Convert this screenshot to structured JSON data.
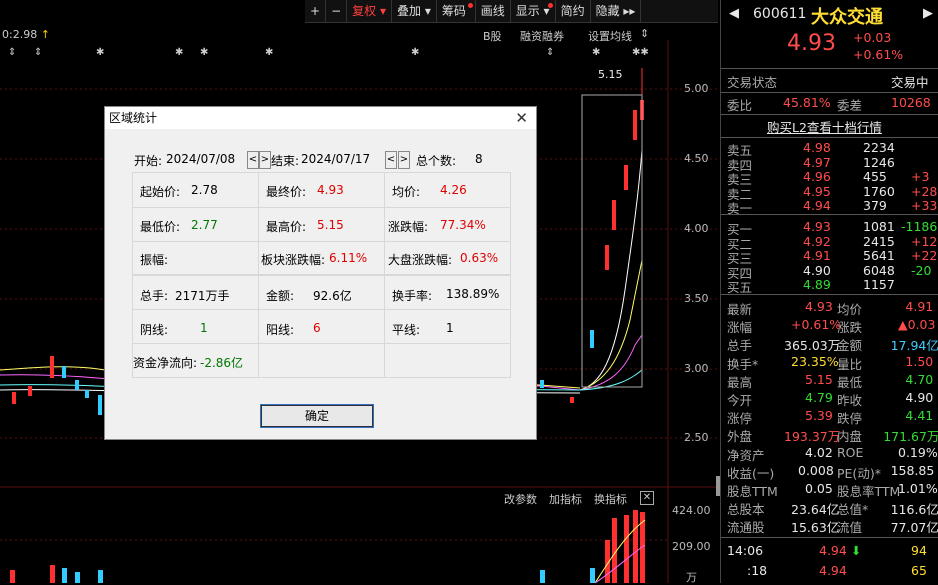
{
  "toolbar": {
    "buttons": [
      "+",
      "−",
      "复权",
      "叠加",
      "筹码",
      "画线",
      "显示",
      "简约",
      "隐藏"
    ]
  },
  "chart_header": {
    "left_label": "0:2.98",
    "right_items": [
      "B股",
      "融资融券",
      "设置均线"
    ],
    "peak_label": "5.15"
  },
  "price_axis": [
    "5.00",
    "4.50",
    "4.00",
    "3.50",
    "3.00",
    "2.50"
  ],
  "volume_header": [
    "改参数",
    "加指标",
    "换指标"
  ],
  "volume_axis": [
    "424.00",
    "209.00",
    "万"
  ],
  "dialog": {
    "title": "区域统计",
    "start_label": "开始:",
    "start_date": "2024/07/08",
    "end_label": "结束:",
    "end_date": "2024/07/17",
    "count_label": "总个数:",
    "count": "8",
    "open_label": "起始价:",
    "open": "2.78",
    "close_label": "最终价:",
    "close": "4.93",
    "avg_label": "均价:",
    "avg": "4.26",
    "low_label": "最低价:",
    "low": "2.77",
    "high_label": "最高价:",
    "high": "5.15",
    "chg_label": "涨跌幅:",
    "chg": "77.34%",
    "amp_label": "振幅:",
    "sector_label": "板块涨跌幅:",
    "sector": "6.11%",
    "market_label": "大盘涨跌幅:",
    "market": "0.63%",
    "hand_label": "总手:",
    "hand": "2171万手",
    "amount_label": "金额:",
    "amount": "92.6亿",
    "turnover_label": "换手率:",
    "turnover": "138.89%",
    "yin_label": "阴线:",
    "yin": "1",
    "yang_label": "阳线:",
    "yang": "6",
    "flat_label": "平线:",
    "flat": "1",
    "flow_label": "资金净流向:",
    "flow": "-2.86亿",
    "ok": "确定"
  },
  "quote": {
    "code": "600611",
    "name": "大众交通",
    "price": "4.93",
    "change": "+0.03",
    "change_pct": "+0.61%",
    "status_label": "交易状态",
    "status": "交易中",
    "webi_label": "委比",
    "webi": "45.81%",
    "weicha_label": "委差",
    "weicha": "10268",
    "l2_link": "购买L2查看十档行情",
    "asks": [
      {
        "label": "卖五",
        "price": "4.98",
        "vol": "2234",
        "chg": ""
      },
      {
        "label": "卖四",
        "price": "4.97",
        "vol": "1246",
        "chg": ""
      },
      {
        "label": "卖三",
        "price": "4.96",
        "vol": "455",
        "chg": "+3"
      },
      {
        "label": "卖二",
        "price": "4.95",
        "vol": "1760",
        "chg": "+28"
      },
      {
        "label": "卖一",
        "price": "4.94",
        "vol": "379",
        "chg": "+33"
      }
    ],
    "bids": [
      {
        "label": "买一",
        "price": "4.93",
        "vol": "1081",
        "chg": "-1186"
      },
      {
        "label": "买二",
        "price": "4.92",
        "vol": "2415",
        "chg": "+12"
      },
      {
        "label": "买三",
        "price": "4.91",
        "vol": "5641",
        "chg": "+22"
      },
      {
        "label": "买四",
        "price": "4.90",
        "vol": "6048",
        "chg": "-20"
      },
      {
        "label": "买五",
        "price": "4.89",
        "vol": "1157",
        "chg": ""
      }
    ],
    "stats": [
      {
        "l1": "最新",
        "v1": "4.93",
        "l2": "均价",
        "v2": "4.91"
      },
      {
        "l1": "涨幅",
        "v1": "+0.61%",
        "l2": "涨跌",
        "v2": "▲0.03"
      },
      {
        "l1": "总手",
        "v1": "365.03万",
        "l2": "金额",
        "v2": "17.94亿"
      },
      {
        "l1": "换手*",
        "v1": "23.35%",
        "l2": "量比",
        "v2": "1.50"
      },
      {
        "l1": "最高",
        "v1": "5.15",
        "l2": "最低",
        "v2": "4.70"
      },
      {
        "l1": "今开",
        "v1": "4.79",
        "l2": "昨收",
        "v2": "4.90"
      },
      {
        "l1": "涨停",
        "v1": "5.39",
        "l2": "跌停",
        "v2": "4.41"
      },
      {
        "l1": "外盘",
        "v1": "193.37万",
        "l2": "内盘",
        "v2": "171.67万"
      },
      {
        "l1": "净资产",
        "v1": "4.02",
        "l2": "ROE",
        "v2": "0.19%"
      },
      {
        "l1": "收益(一)",
        "v1": "0.008",
        "l2": "PE(动)*",
        "v2": "158.85"
      },
      {
        "l1": "股息TTM",
        "v1": "0.05",
        "l2": "股息率TTM",
        "v2": "1.01%"
      },
      {
        "l1": "总股本",
        "v1": "23.64亿",
        "l2": "总值*",
        "v2": "116.6亿"
      },
      {
        "l1": "流通股",
        "v1": "15.63亿",
        "l2": "流值",
        "v2": "77.07亿"
      }
    ],
    "ticks": [
      {
        "time": "14:06",
        "price": "4.94",
        "vol": "94"
      },
      {
        "time": ":18",
        "price": "4.94",
        "vol": "65"
      }
    ]
  }
}
